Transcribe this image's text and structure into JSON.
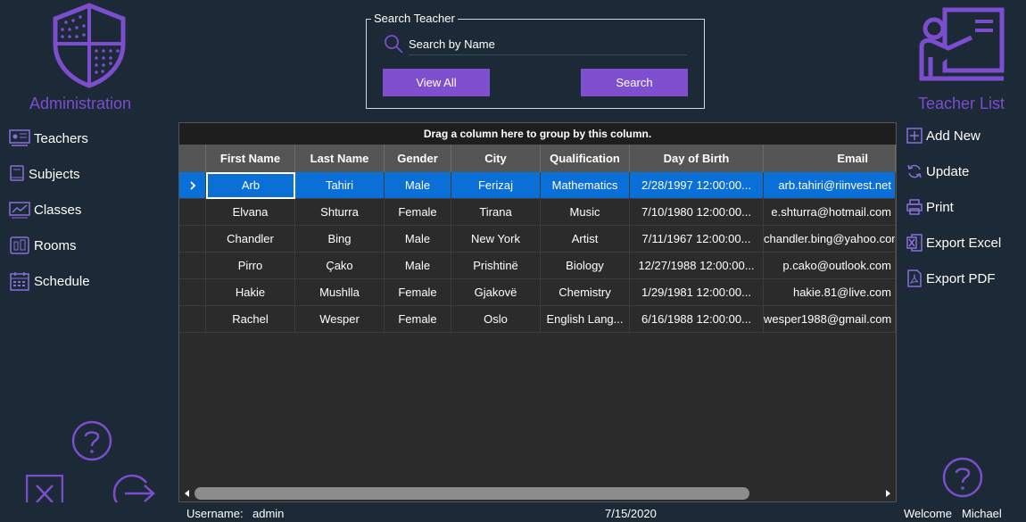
{
  "sidebar": {
    "title": "Administration",
    "items": [
      {
        "label": "Teachers",
        "icon": "teachers-icon"
      },
      {
        "label": "Subjects",
        "icon": "subjects-icon"
      },
      {
        "label": "Classes",
        "icon": "classes-icon"
      },
      {
        "label": "Rooms",
        "icon": "rooms-icon"
      },
      {
        "label": "Schedule",
        "icon": "schedule-icon"
      }
    ]
  },
  "search": {
    "legend": "Search Teacher",
    "placeholder": "Search by Name",
    "view_all_label": "View All",
    "search_label": "Search"
  },
  "grid": {
    "group_panel_text": "Drag a column here to group by this column.",
    "columns": [
      "First Name",
      "Last Name",
      "Gender",
      "City",
      "Qualification",
      "Day of Birth",
      "Email"
    ],
    "rows": [
      [
        "Arb",
        "Tahiri",
        "Male",
        "Ferizaj",
        "Mathematics",
        "2/28/1997  12:00:00...",
        "arb.tahiri@riinvest.net"
      ],
      [
        "Elvana",
        "Shturra",
        "Female",
        "Tirana",
        "Music",
        "7/10/1980  12:00:00...",
        "e.shturra@hotmail.com"
      ],
      [
        "Chandler",
        "Bing",
        "Male",
        "New York",
        "Artist",
        "7/11/1967  12:00:00...",
        "chandler.bing@yahoo.com"
      ],
      [
        "Pirro",
        "Çako",
        "Male",
        "Prishtinë",
        "Biology",
        "12/27/1988  12:00:00...",
        "p.cako@outlook.com"
      ],
      [
        "Hakie",
        "Mushlla",
        "Female",
        "Gjakovë",
        "Chemistry",
        "1/29/1981  12:00:00...",
        "hakie.81@live.com"
      ],
      [
        "Rachel",
        "Wesper",
        "Female",
        "Oslo",
        "English  Lang...",
        "6/16/1988  12:00:00...",
        "wesper1988@gmail.com"
      ]
    ],
    "selected_row": 0
  },
  "actions": {
    "title": "Teacher List",
    "items": [
      {
        "label": "Add New",
        "icon": "add-icon"
      },
      {
        "label": "Update",
        "icon": "refresh-icon"
      },
      {
        "label": "Print",
        "icon": "printer-icon"
      },
      {
        "label": "Export Excel",
        "icon": "excel-icon"
      },
      {
        "label": "Export PDF",
        "icon": "pdf-icon"
      }
    ]
  },
  "status": {
    "username_label": "Username:",
    "username": "admin",
    "date": "7/15/2020",
    "welcome_label": "Welcome",
    "user": "Michael"
  },
  "colors": {
    "accent": "#7f4fcf",
    "background": "#1c2936",
    "selection": "#0a6fd6",
    "grid_bg": "#2b2b2b"
  }
}
